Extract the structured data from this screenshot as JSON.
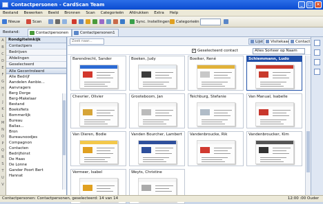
{
  "window": {
    "title": "Contactpersonen - CardScan Team"
  },
  "menu": [
    "Bestand",
    "Bewerken",
    "Beeld",
    "Bronnen",
    "Scan",
    "Categorieën",
    "Afdrukken",
    "Extra",
    "Help"
  ],
  "toolbar": {
    "new_label": "Nieuw",
    "scan_label": "Scan",
    "sync_label": "Sync. Instellingen",
    "categories_label": "Categorieën",
    "select_value": "",
    "colors": {
      "new": "#3d7ad6",
      "scan": "#d1493a",
      "sync": "#3aa04a",
      "cat": "#e0a020"
    }
  },
  "tabs": {
    "section_label": "Bestand:",
    "items": [
      {
        "label": "Contactpersonen",
        "active": true
      },
      {
        "label": "Contactpersonen1",
        "active": false
      }
    ]
  },
  "left_strip": [
    "A",
    "B",
    "C",
    "D",
    "E",
    "F",
    "G",
    "H",
    "I",
    "J",
    "K",
    "L",
    "M",
    "N",
    "O",
    "P",
    "Q",
    "R",
    "S",
    "T",
    "U",
    "V"
  ],
  "nav": {
    "header": "Rondgitelmkijk",
    "groups": [
      {
        "label": "Contactpers",
        "selected": true
      },
      {
        "label": "Bedrijven"
      },
      {
        "label": "Afdelingen"
      },
      {
        "label": "Geselecteerd"
      }
    ],
    "bar_label": "Alle   Gecontroleerd",
    "items": [
      "Alle Bedrijf",
      "Aandelen Aanbie...",
      "Aanvragers",
      "Berg Dorge",
      "Berg-Makelaar",
      "Bestand",
      "Boeksfiets",
      "Bommerlijk",
      "Bureau",
      "Ballas...",
      "Bron",
      "Bureaunoodjes",
      "Compagnon",
      "Contacten",
      "Bedrijfsinst",
      "De Haas",
      "De Lonne",
      "Gander Poort Bert",
      "Hannat"
    ]
  },
  "main": {
    "search_placeholder": "Zoek naar...",
    "views": [
      {
        "label": "Lijst",
        "active": true
      },
      {
        "label": "Visitekaart",
        "active": false
      },
      {
        "label": "Contact",
        "active": false
      }
    ],
    "filter_label": "Geselecteerd contact",
    "filter_checked": true,
    "sort_value": "Alles Sorteer op Naam",
    "cards": [
      {
        "name": "Barendrecht, Sander",
        "selected": false,
        "accent": "#2c6bd4",
        "logo": "#d2372c"
      },
      {
        "name": "Boeken, Judy",
        "selected": false,
        "accent": "#e9eef3",
        "logo": "#3c3c3c"
      },
      {
        "name": "Boeiker, René",
        "selected": false,
        "accent": "#e1b23a",
        "logo": "#c8c8c8"
      },
      {
        "name": "Schiemmann, Ludo",
        "selected": true,
        "accent": "#c83a2c",
        "logo": "#c83a2c"
      },
      {
        "name": "Chevrier, Olivier",
        "selected": false,
        "accent": "#f4f4f4",
        "logo": "#d6a437"
      },
      {
        "name": "Grooteboom, Jan",
        "selected": false,
        "accent": "#f4f4f4",
        "logo": "#bbbbbb"
      },
      {
        "name": "Teichburg, Stefanie",
        "selected": false,
        "accent": "#f4f4f4",
        "logo": "#b0bcc8"
      },
      {
        "name": "Van Manual, Isabelle",
        "selected": false,
        "accent": "#f0f0f0",
        "logo": "#c8372c"
      },
      {
        "name": "Van Dieren, Bodie",
        "selected": false,
        "accent": "#f3c84a",
        "logo": "#e0a020"
      },
      {
        "name": "Vanden Bourcher, Lambert",
        "selected": false,
        "accent": "#2e4f9c",
        "logo": "#2e4f9c"
      },
      {
        "name": "Vandenbroucke, Rik",
        "selected": false,
        "accent": "#f4f4f4",
        "logo": "#d03a30"
      },
      {
        "name": "Vandenbroucker, Kim",
        "selected": false,
        "accent": "#555555",
        "logo": "#333333"
      },
      {
        "name": "Vermeer, Isabel",
        "selected": false,
        "accent": "#f4f4f4",
        "logo": "#e0a020"
      },
      {
        "name": "Weyts, Christine",
        "selected": false,
        "accent": "#f4f4f4",
        "logo": "#aaaaaa"
      }
    ]
  },
  "status": {
    "left": "Contactpersonen: Contactpersonen, geselecteerd: 14 van 14",
    "right": "12:00 :00 Ouder"
  }
}
